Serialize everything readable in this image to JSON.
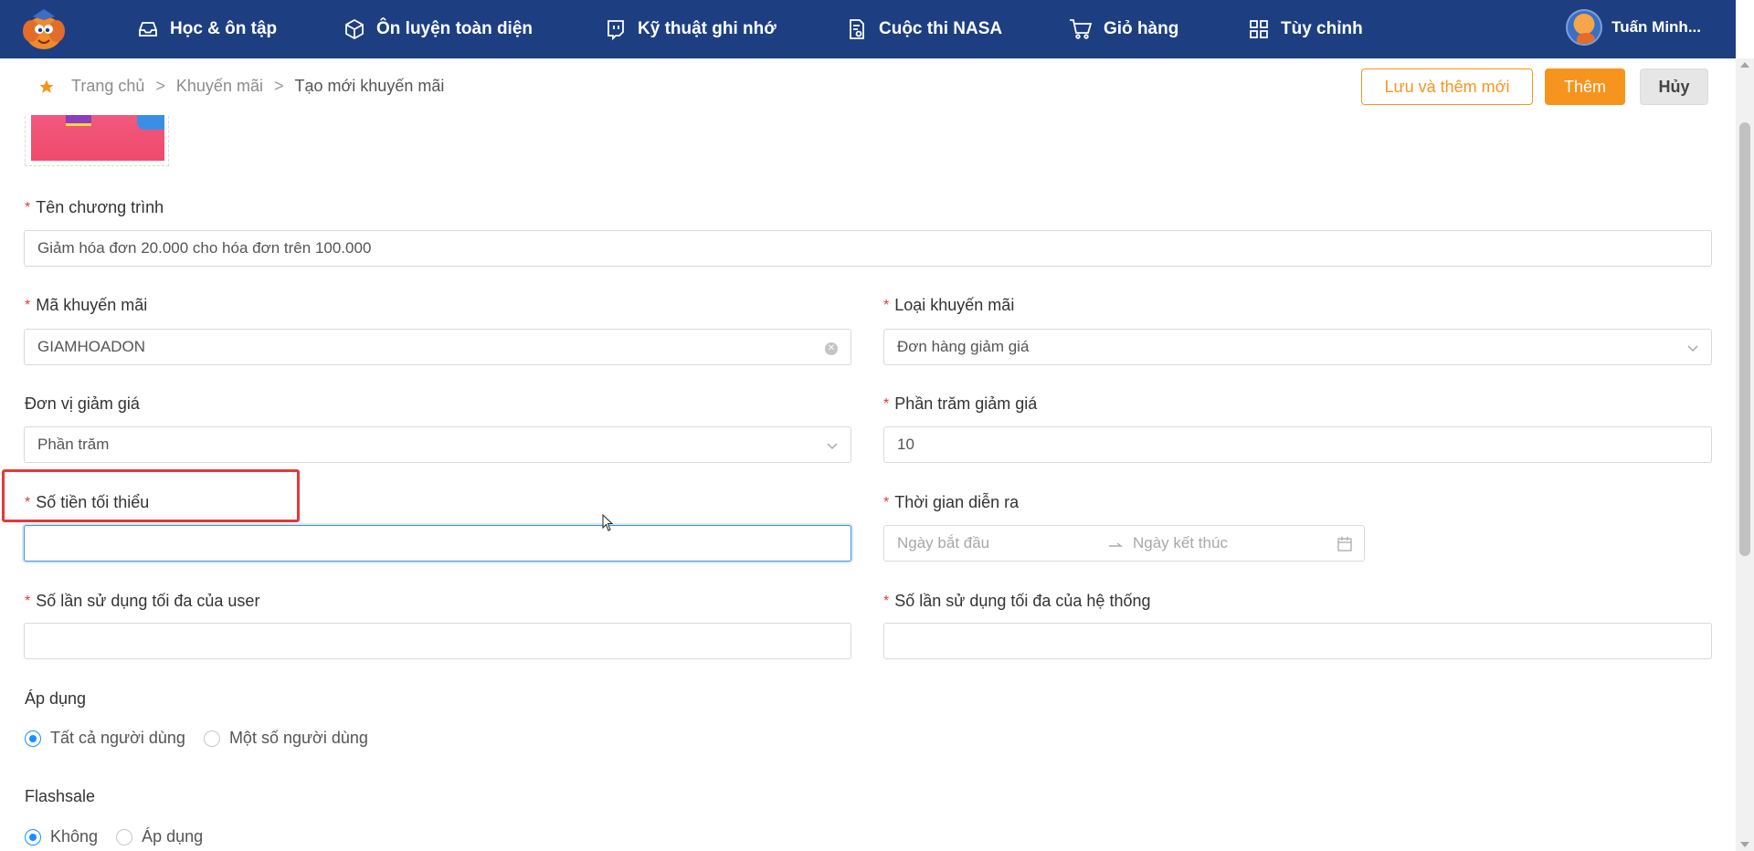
{
  "nav": {
    "items": [
      {
        "label": "Học & ôn tập",
        "icon": "inbox-icon"
      },
      {
        "label": "Ôn luyện toàn diện",
        "icon": "cube-icon"
      },
      {
        "label": "Kỹ thuật ghi nhớ",
        "icon": "twitch-chat-icon"
      },
      {
        "label": "Cuộc thi NASA",
        "icon": "document-icon"
      },
      {
        "label": "Giỏ hàng",
        "icon": "cart-icon"
      },
      {
        "label": "Tùy chỉnh",
        "icon": "grid-icon"
      }
    ],
    "user_name": "Tuấn Minh..."
  },
  "breadcrumb": {
    "home": "Trang chủ",
    "section": "Khuyến mãi",
    "current": "Tạo mới khuyến mãi",
    "separator": ">"
  },
  "actions": {
    "save_and_new": "Lưu và thêm mới",
    "add": "Thêm",
    "cancel": "Hủy"
  },
  "form": {
    "required_mark": "*",
    "program_name": {
      "label": "Tên chương trình",
      "value": "Giảm hóa đơn 20.000 cho hóa đơn trên 100.000"
    },
    "promo_code": {
      "label": "Mã khuyến mãi",
      "value": "GIAMHOADON"
    },
    "promo_type": {
      "label": "Loại khuyến mãi",
      "value": "Đơn hàng giảm giá"
    },
    "discount_unit": {
      "label": "Đơn vị giảm giá",
      "value": "Phần trăm"
    },
    "discount_percent": {
      "label": "Phần trăm giảm giá",
      "value": "10"
    },
    "min_amount": {
      "label": "Số tiền tối thiểu",
      "value": ""
    },
    "duration": {
      "label": "Thời gian diễn ra",
      "start_placeholder": "Ngày bắt đầu",
      "end_placeholder": "Ngày kết thúc"
    },
    "max_uses_user": {
      "label": "Số lần sử dụng tối đa của user",
      "value": ""
    },
    "max_uses_system": {
      "label": "Số lần sử dụng tối đa của hệ thống",
      "value": ""
    },
    "apply": {
      "label": "Áp dụng",
      "options": [
        "Tất cả người dùng",
        "Một số người dùng"
      ],
      "selected": "Tất cả người dùng"
    },
    "flashsale": {
      "label": "Flashsale",
      "options": [
        "Không",
        "Áp dụng"
      ],
      "selected": "Không"
    }
  },
  "colors": {
    "nav_bg": "#1d3f82",
    "accent": "#f7941d",
    "required": "#e53935",
    "focus": "#4a90d9",
    "radio_selected": "#1890ff"
  }
}
